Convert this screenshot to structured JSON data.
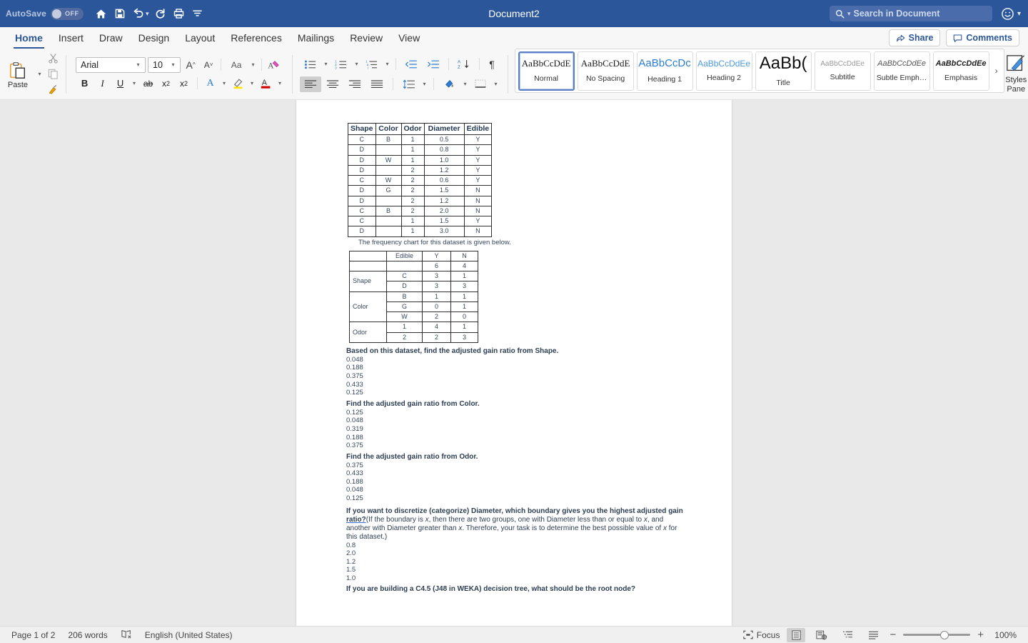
{
  "titlebar": {
    "autosave_label": "AutoSave",
    "autosave_state": "OFF",
    "document_title": "Document2",
    "quick_access": [
      {
        "name": "home-icon",
        "label": "Home"
      },
      {
        "name": "save-icon",
        "label": "Save"
      },
      {
        "name": "undo-icon",
        "label": "Undo"
      },
      {
        "name": "redo-icon",
        "label": "Redo"
      },
      {
        "name": "print-icon",
        "label": "Print"
      },
      {
        "name": "customize-quick-access-icon",
        "label": "Customize Quick Access Toolbar"
      }
    ],
    "search_placeholder": "Search in Document"
  },
  "tabs": [
    {
      "label": "Home",
      "active": true
    },
    {
      "label": "Insert",
      "active": false
    },
    {
      "label": "Draw",
      "active": false
    },
    {
      "label": "Design",
      "active": false
    },
    {
      "label": "Layout",
      "active": false
    },
    {
      "label": "References",
      "active": false
    },
    {
      "label": "Mailings",
      "active": false
    },
    {
      "label": "Review",
      "active": false
    },
    {
      "label": "View",
      "active": false
    }
  ],
  "tab_tools": {
    "share_label": "Share",
    "comments_label": "Comments"
  },
  "ribbon": {
    "paste_label": "Paste",
    "font_name": "Arial",
    "font_size": "10",
    "styles_pane_label_line1": "Styles",
    "styles_pane_label_line2": "Pane",
    "gallery_more": "›",
    "styles": [
      {
        "preview": "AaBbCcDdE",
        "name": "Normal",
        "selected": true,
        "cls": "serif-prev"
      },
      {
        "preview": "AaBbCcDdE",
        "name": "No Spacing",
        "selected": false,
        "cls": "serif-prev"
      },
      {
        "preview": "AaBbCcDc",
        "name": "Heading 1",
        "selected": false,
        "cls": "h1-prev"
      },
      {
        "preview": "AaBbCcDdEe",
        "name": "Heading 2",
        "selected": false,
        "cls": "h2-prev"
      },
      {
        "preview": "AaBb(",
        "name": "Title",
        "selected": false,
        "cls": "title-prev"
      },
      {
        "preview": "AaBbCcDdEe",
        "name": "Subtitle",
        "selected": false,
        "cls": "sub-prev"
      },
      {
        "preview": "AaBbCcDdEe",
        "name": "Subtle Emph…",
        "selected": false,
        "cls": "semph-prev"
      },
      {
        "preview": "AaBbCcDdEe",
        "name": "Emphasis",
        "selected": false,
        "cls": "emph-prev"
      }
    ]
  },
  "document": {
    "dataset_table": {
      "headers": [
        "Shape",
        "Color",
        "Odor",
        "Diameter",
        "Edible"
      ],
      "rows": [
        [
          "C",
          "B",
          "1",
          "0.5",
          "Y"
        ],
        [
          "D",
          "",
          "1",
          "0.8",
          "Y"
        ],
        [
          "D",
          "W",
          "1",
          "1.0",
          "Y"
        ],
        [
          "D",
          "",
          "2",
          "1.2",
          "Y"
        ],
        [
          "C",
          "W",
          "2",
          "0.6",
          "Y"
        ],
        [
          "D",
          "G",
          "2",
          "1.5",
          "N"
        ],
        [
          "D",
          "",
          "2",
          "1.2",
          "N"
        ],
        [
          "C",
          "B",
          "2",
          "2.0",
          "N"
        ],
        [
          "C",
          "",
          "1",
          "1.5",
          "Y"
        ],
        [
          "D",
          "",
          "1",
          "3.0",
          "N"
        ]
      ]
    },
    "caption": "The frequency chart for this dataset is given below.",
    "frequency_table": {
      "header": [
        "",
        "Edible",
        "Y",
        "N"
      ],
      "total_row": [
        "",
        "",
        "6",
        "4"
      ],
      "groups": [
        {
          "name": "Shape",
          "rows": [
            [
              "C",
              "3",
              "1"
            ],
            [
              "D",
              "3",
              "3"
            ]
          ]
        },
        {
          "name": "Color",
          "rows": [
            [
              "B",
              "1",
              "1"
            ],
            [
              "G",
              "0",
              "1"
            ],
            [
              "W",
              "2",
              "0"
            ]
          ]
        },
        {
          "name": "Odor",
          "rows": [
            [
              "1",
              "4",
              "1"
            ],
            [
              "2",
              "2",
              "3"
            ]
          ]
        }
      ]
    },
    "questions": [
      {
        "prompt": "Based on this dataset, find the adjusted gain ratio from Shape.",
        "options": [
          "0.048",
          "0.188",
          "0.375",
          "0.433",
          "0.125"
        ]
      },
      {
        "prompt": "Find the adjusted gain ratio from Color.",
        "options": [
          "0.125",
          "0.048",
          "0.319",
          "0.188",
          "0.375"
        ]
      },
      {
        "prompt": "Find the adjusted gain ratio from Odor.",
        "options": [
          "0.375",
          "0.433",
          "0.188",
          "0.048",
          "0.125"
        ]
      }
    ],
    "q4": {
      "bold_part_a": "If you want to discretize (categorize) Diameter, which boundary gives you the highest adjusted gain ",
      "bold_link": "ratio?",
      "paren_1": "(If the boundary is ",
      "x1": "x",
      "paren_2": ", then there are two groups, one with Diameter less than or equal to ",
      "x2": "x",
      "paren_3": ", and another with Diameter greater than ",
      "x3": "x",
      "paren_4": ". Therefore, your task is to determine the best possible value of ",
      "x4": "x",
      "paren_5": " for this dataset.)",
      "options": [
        "0.8",
        "2.0",
        "1.2",
        "1.5",
        "1.0"
      ]
    },
    "q5": {
      "prompt": "If you are building a C4.5 (J48 in WEKA) decision tree, what should be the root node?"
    }
  },
  "statusbar": {
    "page_info": "Page 1 of 2",
    "word_count": "206 words",
    "proofing_icon": "proofing-errors-icon",
    "language": "English (United States)",
    "focus_label": "Focus",
    "zoom_level": "100%"
  },
  "colors": {
    "titlebar": "#2b579a",
    "accent": "#2b579a",
    "ribbon_bg": "#f7f7f7",
    "doc_bg": "#e9e9e9",
    "table_text": "#33475e"
  }
}
